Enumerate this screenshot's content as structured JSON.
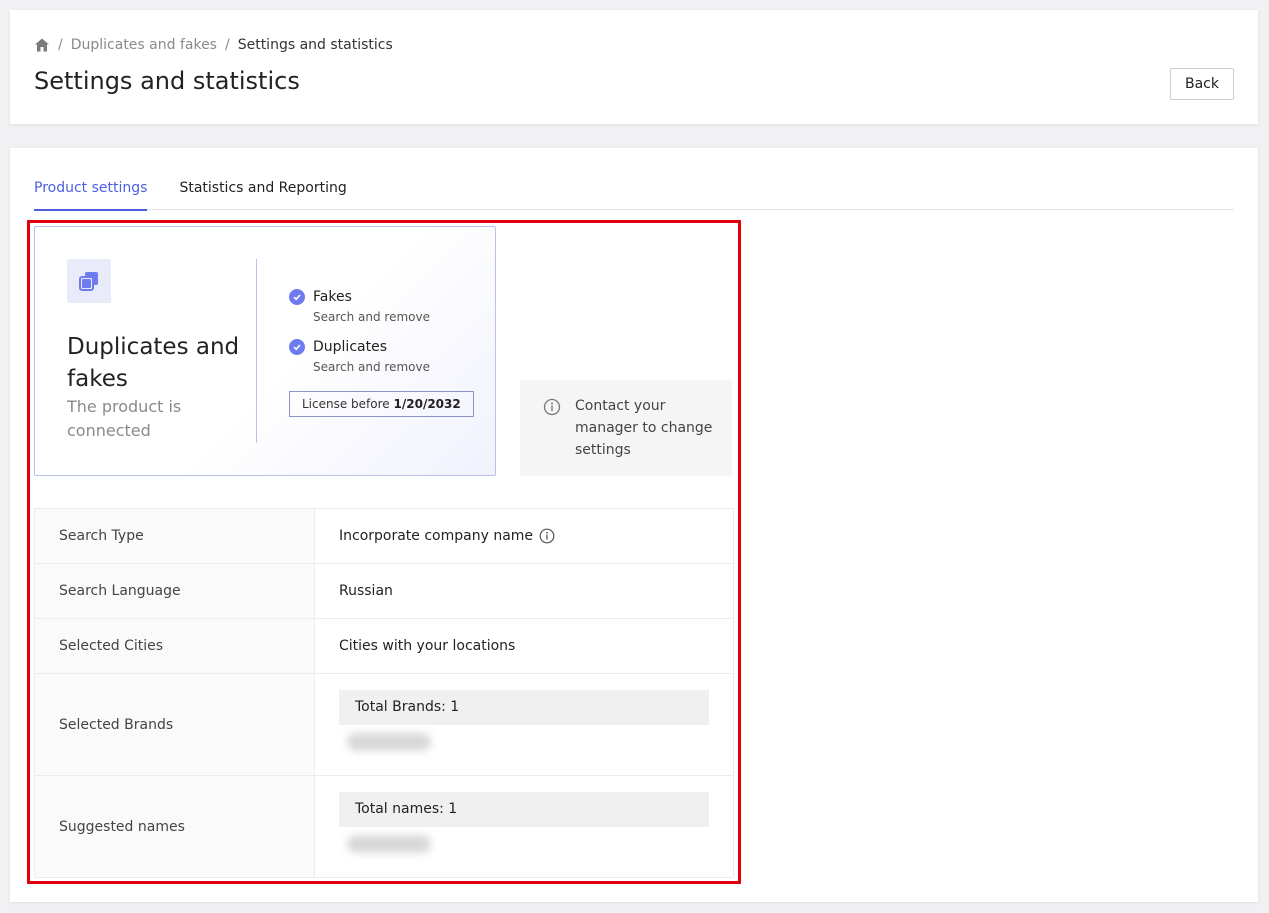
{
  "breadcrumb": {
    "home_icon": "home-icon",
    "items": [
      "Duplicates and fakes",
      "Settings and statistics"
    ],
    "separator": "/"
  },
  "header": {
    "title": "Settings and statistics",
    "back_label": "Back"
  },
  "tabs": [
    {
      "label": "Product settings",
      "active": true
    },
    {
      "label": "Statistics and Reporting",
      "active": false
    }
  ],
  "product": {
    "icon": "copy-icon",
    "name": "Duplicates and fakes",
    "status": "The product is connected",
    "features": [
      {
        "title": "Fakes",
        "subtitle": "Search and remove"
      },
      {
        "title": "Duplicates",
        "subtitle": "Search and remove"
      }
    ],
    "license_prefix": "License before",
    "license_date": "1/20/2032"
  },
  "notice": {
    "icon": "info-icon",
    "text": "Contact your manager to change settings"
  },
  "settings": {
    "search_type": {
      "label": "Search Type",
      "value": "Incorporate company name"
    },
    "search_language": {
      "label": "Search Language",
      "value": "Russian"
    },
    "selected_cities": {
      "label": "Selected Cities",
      "value": "Cities with your locations"
    },
    "selected_brands": {
      "label": "Selected Brands",
      "total": "Total Brands: 1"
    },
    "suggested_names": {
      "label": "Suggested names",
      "total": "Total names: 1"
    }
  },
  "colors": {
    "accent": "#4b5fe0",
    "check": "#6f7cf0",
    "highlight": "#e0000b"
  }
}
